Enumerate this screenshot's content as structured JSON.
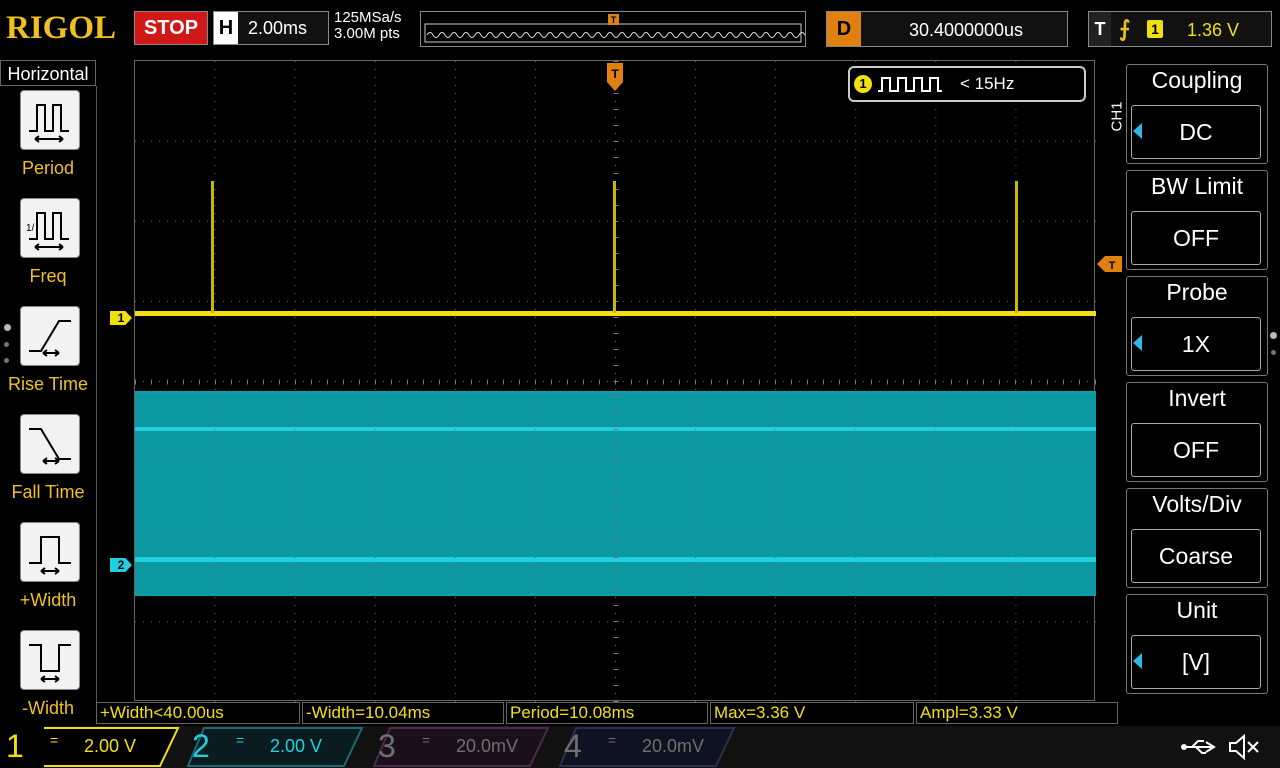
{
  "header": {
    "logo": "RIGOL",
    "run_status": "STOP",
    "horizontal_label": "H",
    "timebase": "2.00ms",
    "sample_rate": "125MSa/s",
    "memory_depth": "3.00M pts",
    "delay_label": "D",
    "delay_value": "30.4000000us",
    "trigger_label": "T",
    "trigger_source": "1",
    "trigger_level": "1.36 V"
  },
  "left_menu": {
    "title": "Horizontal",
    "items": [
      {
        "label": "Period",
        "icon": "period-icon"
      },
      {
        "label": "Freq",
        "icon": "freq-icon"
      },
      {
        "label": "Rise Time",
        "icon": "rise-time-icon"
      },
      {
        "label": "Fall Time",
        "icon": "fall-time-icon"
      },
      {
        "label": "+Width",
        "icon": "positive-width-icon"
      },
      {
        "label": "-Width",
        "icon": "negative-width-icon"
      }
    ]
  },
  "frequency_counter": {
    "channel": "1",
    "value": "< 15Hz"
  },
  "channel_markers": {
    "ch1": "1",
    "ch2": "2"
  },
  "right_menu": {
    "channel_tag": "CH1",
    "items": [
      {
        "title": "Coupling",
        "value": "DC"
      },
      {
        "title": "BW Limit",
        "value": "OFF"
      },
      {
        "title": "Probe",
        "value": "1X"
      },
      {
        "title": "Invert",
        "value": "OFF"
      },
      {
        "title": "Volts/Div",
        "value": "Coarse"
      },
      {
        "title": "Unit",
        "value": "[V]"
      }
    ]
  },
  "measurements": [
    "+Width<40.00us",
    "-Width=10.04ms",
    "Period=10.08ms",
    "Max=3.36 V",
    "Ampl=3.33 V"
  ],
  "channels": [
    {
      "num": "1",
      "coupling": "=",
      "scale": "2.00 V",
      "color": "#f0e010",
      "active": true
    },
    {
      "num": "2",
      "coupling": "=",
      "scale": "2.00 V",
      "color": "#20d0e0",
      "active": true
    },
    {
      "num": "3",
      "coupling": "=",
      "scale": "20.0mV",
      "color": "#707070",
      "active": false
    },
    {
      "num": "4",
      "coupling": "=",
      "scale": "20.0mV",
      "color": "#707070",
      "active": false
    }
  ],
  "colors": {
    "ch1": "#f0e010",
    "ch2": "#20d0e0",
    "ch2_fill": "#0ea0a8",
    "trigger": "#e08010"
  }
}
